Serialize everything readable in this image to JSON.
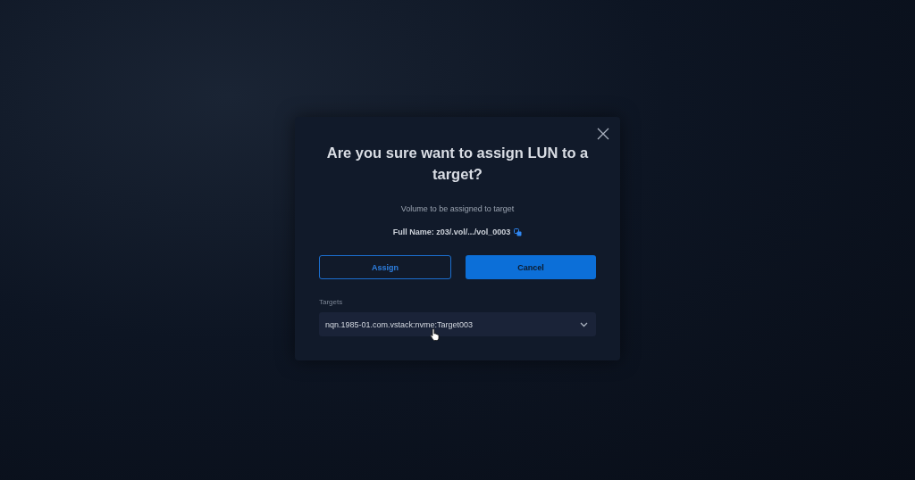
{
  "dialog": {
    "title": "Are you sure want to assign LUN to a target?",
    "subtitle": "Volume to be assigned to target",
    "full_name": "Full Name: z03/.vol/.../vol_0003",
    "buttons": [
      {
        "label": "Assign",
        "kind": "outline"
      },
      {
        "label": "Cancel",
        "kind": "filled"
      }
    ],
    "targets": {
      "label": "Targets",
      "value": "nqn.1985-01.com.vstack:nvme:Target003"
    }
  }
}
